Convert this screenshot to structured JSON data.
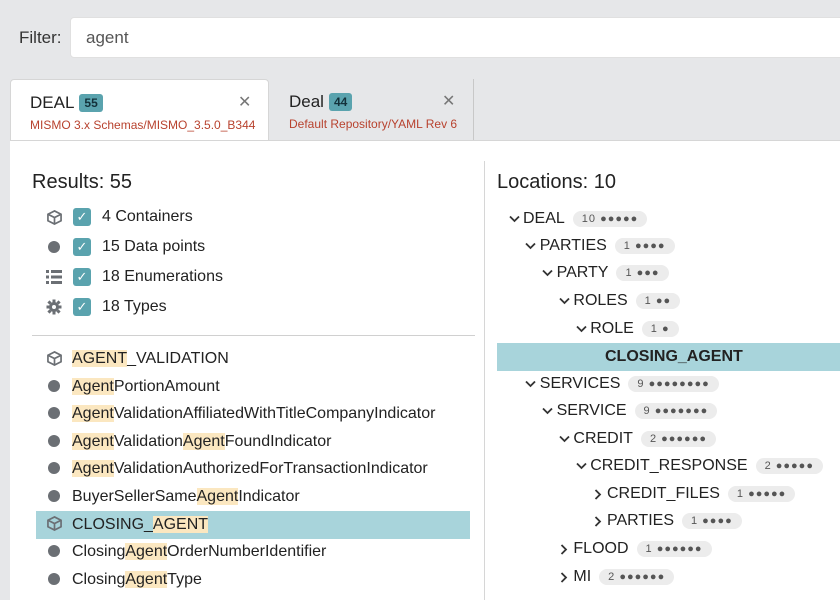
{
  "filter": {
    "label": "Filter:",
    "value": "agent"
  },
  "tabs": [
    {
      "title": "DEAL",
      "count": "55",
      "subtitle": "MISMO 3.x Schemas/MISMO_3.5.0_B344",
      "close": "✕"
    },
    {
      "title": "Deal",
      "count": "44",
      "subtitle": "Default Repository/YAML Rev 6",
      "close": "✕"
    }
  ],
  "results": {
    "header": "Results: 55",
    "categories": [
      {
        "icon": "cube-icon",
        "label": "4 Containers"
      },
      {
        "icon": "dot-icon",
        "label": "15 Data points"
      },
      {
        "icon": "list-icon",
        "label": "18 Enumerations"
      },
      {
        "icon": "gear-icon",
        "label": "18 Types"
      }
    ],
    "items": [
      {
        "icon": "cube-icon",
        "parts": [
          [
            "AGENT",
            true
          ],
          [
            "_VALIDATION",
            false
          ]
        ]
      },
      {
        "icon": "dot-icon",
        "parts": [
          [
            "Agent",
            true
          ],
          [
            "PortionAmount",
            false
          ]
        ]
      },
      {
        "icon": "dot-icon",
        "parts": [
          [
            "Agent",
            true
          ],
          [
            "ValidationAffiliatedWithTitleCompanyIndicator",
            false
          ]
        ]
      },
      {
        "icon": "dot-icon",
        "parts": [
          [
            "Agent",
            true
          ],
          [
            "Validation",
            false
          ],
          [
            "Agent",
            true
          ],
          [
            "FoundIndicator",
            false
          ]
        ]
      },
      {
        "icon": "dot-icon",
        "parts": [
          [
            "Agent",
            true
          ],
          [
            "ValidationAuthorizedForTransactionIndicator",
            false
          ]
        ]
      },
      {
        "icon": "dot-icon",
        "parts": [
          [
            "BuyerSellerSame",
            false
          ],
          [
            "Agent",
            true
          ],
          [
            "Indicator",
            false
          ]
        ]
      },
      {
        "icon": "cube-icon",
        "parts": [
          [
            "CLOSING_",
            false
          ],
          [
            "AGENT",
            true
          ]
        ],
        "selected": true
      },
      {
        "icon": "dot-icon",
        "parts": [
          [
            "Closing",
            false
          ],
          [
            "Agent",
            true
          ],
          [
            "OrderNumberIdentifier",
            false
          ]
        ]
      },
      {
        "icon": "dot-icon",
        "parts": [
          [
            "Closing",
            false
          ],
          [
            "Agent",
            true
          ],
          [
            "Type",
            false
          ]
        ]
      }
    ]
  },
  "locations": {
    "header": "Locations: 10",
    "nodes": [
      {
        "label": "DEAL",
        "pill": "10 ●●●●●",
        "chev": "down",
        "depth": 0
      },
      {
        "label": "PARTIES",
        "pill": "1 ●●●●",
        "chev": "down",
        "depth": 1
      },
      {
        "label": "PARTY",
        "pill": "1 ●●●",
        "chev": "down",
        "depth": 2
      },
      {
        "label": "ROLES",
        "pill": "1 ●●",
        "chev": "down",
        "depth": 3
      },
      {
        "label": "ROLE",
        "pill": "1 ●",
        "chev": "down",
        "depth": 4
      },
      {
        "label": "CLOSING_AGENT",
        "selected": true,
        "depth": 5
      },
      {
        "label": "SERVICES",
        "pill": "9 ●●●●●●●●",
        "chev": "down",
        "depth": 1
      },
      {
        "label": "SERVICE",
        "pill": "9 ●●●●●●●",
        "chev": "down",
        "depth": 2
      },
      {
        "label": "CREDIT",
        "pill": "2 ●●●●●●",
        "chev": "down",
        "depth": 3
      },
      {
        "label": "CREDIT_RESPONSE",
        "pill": "2 ●●●●●",
        "chev": "down",
        "depth": 4
      },
      {
        "label": "CREDIT_FILES",
        "pill": "1 ●●●●●",
        "chev": "right",
        "depth": 5
      },
      {
        "label": "PARTIES",
        "pill": "1 ●●●●",
        "chev": "right",
        "depth": 5
      },
      {
        "label": "FLOOD",
        "pill": "1 ●●●●●●",
        "chev": "right",
        "depth": 3
      },
      {
        "label": "MI",
        "pill": "2 ●●●●●●",
        "chev": "right",
        "depth": 3
      }
    ]
  },
  "colors": {
    "accent": "#5aa3ae",
    "selected": "#a8d4db",
    "highlight": "#fbe7c0",
    "subtitle": "#b8422e"
  }
}
